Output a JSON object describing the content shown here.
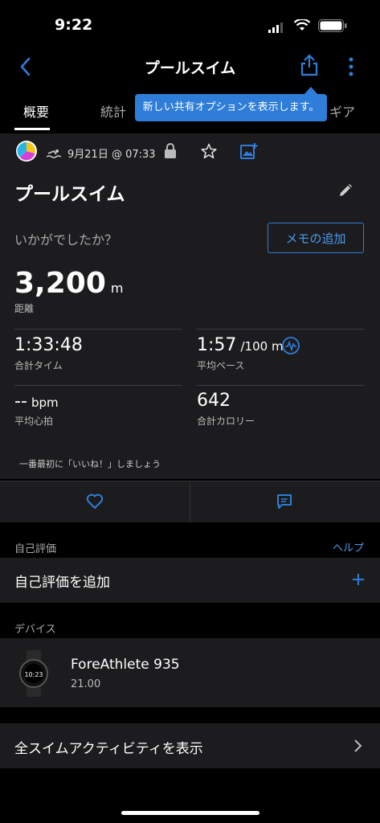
{
  "status": {
    "time": "9:22"
  },
  "navbar": {
    "title": "プールスイム"
  },
  "tabs": [
    {
      "label": "概要"
    },
    {
      "label": "統計"
    },
    {
      "label": "ギア"
    }
  ],
  "tooltip": {
    "text": "新しい共有オプションを表示します。"
  },
  "meta": {
    "date": "9月21日 @ 07:33"
  },
  "activity": {
    "title": "プールスイム",
    "prompt": "いかがでしたか？",
    "memo_button": "メモの追加"
  },
  "distance": {
    "value": "3,200",
    "unit": "m",
    "label": "距離"
  },
  "stats": {
    "total_time": {
      "value": "1:33:48",
      "label": "合計タイム"
    },
    "avg_pace": {
      "value": "1:57",
      "unit": "/100 m",
      "label": "平均ペース"
    },
    "avg_hr": {
      "value": "--",
      "unit": "bpm",
      "label": "平均心拍"
    },
    "calories": {
      "value": "642",
      "label": "合計カロリー"
    }
  },
  "like_prompt": "一番最初に「いいね！」しましょう",
  "self_eval": {
    "header": "自己評価",
    "help": "ヘルプ",
    "add_label": "自己評価を追加"
  },
  "devices": {
    "header": "デバイス",
    "name": "ForeAthlete 935",
    "version": "21.00"
  },
  "all_activities": "全スイムアクティビティを表示",
  "colors": {
    "accent": "#2e7dd8",
    "card": "#1c1c1e"
  }
}
